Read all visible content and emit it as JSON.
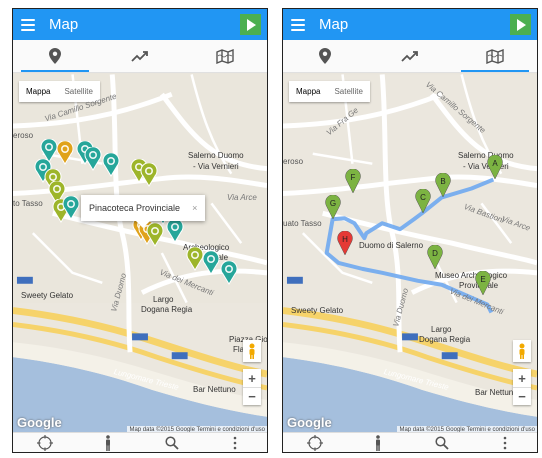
{
  "app": {
    "title": "Map"
  },
  "tabs": [
    {
      "name": "marker-tab",
      "icon": "map-marker-icon"
    },
    {
      "name": "trending-tab",
      "icon": "trending-up-icon"
    },
    {
      "name": "map-tab",
      "icon": "map-icon"
    }
  ],
  "map_type": {
    "roadmap": "Mappa",
    "satellite": "Satellite"
  },
  "bottom_nav": [
    {
      "name": "locate-button",
      "icon": "crosshair-icon"
    },
    {
      "name": "walk-button",
      "icon": "pedestrian-icon"
    },
    {
      "name": "search-button",
      "icon": "search-icon"
    },
    {
      "name": "more-button",
      "icon": "more-vert-icon"
    }
  ],
  "map_labels": {
    "sorgente": "Via Camillo Sorgente",
    "duomo": "Salerno Duomo",
    "duomo_sub": "- Via Vernieri",
    "arce": "Via Arce",
    "bastioni": "Via Bastioni",
    "tasso": "to Tasso",
    "tasso_right": "uato Tasso",
    "duomo_salerno": "Duomo di Salerno",
    "via_duomo": "Via Duomo",
    "via_mercanti": "Via dei Mercanti",
    "museo": "Archeologico",
    "museo_sub": "Provinciale",
    "museo_right": "Museo Archeologico",
    "gelato": "Sweety Gelato",
    "largo": "Largo",
    "dogana": "Dogana Regia",
    "piazza": "Piazza Gio",
    "flavio": "Flavio",
    "lungomare": "Lungomare Trieste",
    "bar": "Bar Nettuno",
    "ss18": "SS18",
    "eroso": "eroso",
    "fra_gen": "Via Fra Ge",
    "google": "Google",
    "attribution": "Map data ©2015 Google   Termini e condizioni d'uso"
  },
  "popup": {
    "title": "Pinacoteca Provinciale",
    "close": "×"
  },
  "route_markers": [
    "A",
    "B",
    "C",
    "D",
    "E",
    "F",
    "G",
    "H"
  ],
  "colors": {
    "app_bar": "#2196F3",
    "play": "#4CAF50",
    "teal_pin": "#26A69A",
    "gold_pin": "#E0A21B",
    "olive_pin": "#9DB52A",
    "green_marker": "#7CB342",
    "red_marker": "#E53935",
    "route": "#6FA8F0"
  }
}
